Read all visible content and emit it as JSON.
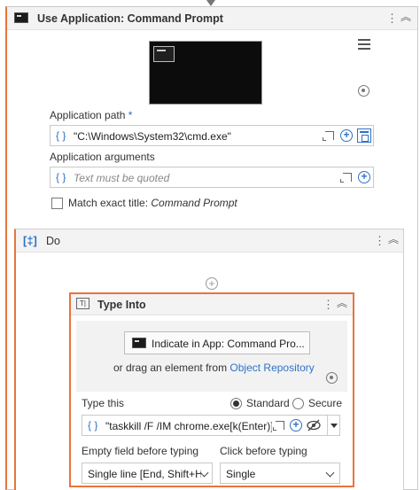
{
  "activity": {
    "title": "Use Application: Command Prompt",
    "application_path_label": "Application path",
    "required_mark": "*",
    "application_path_value": "\"C:\\Windows\\System32\\cmd.exe\"",
    "application_arguments_label": "Application arguments",
    "application_arguments_placeholder": "Text must be quoted",
    "match_exact_title_prefix": "Match exact title:",
    "match_exact_title_value": "Command Prompt",
    "match_exact_title_checked": false
  },
  "do": {
    "title": "Do"
  },
  "type_into": {
    "title": "Type Into",
    "indicate_button_label": "Indicate in App: Command Pro...",
    "drag_prefix": "or drag an element from",
    "object_repository_link": "Object Repository",
    "type_this_label": "Type this",
    "mode_standard": "Standard",
    "mode_secure": "Secure",
    "mode_selected": "Standard",
    "type_this_value": "\"taskkill /F /IM chrome.exe[k(Enter)]",
    "empty_field_label": "Empty field before typing",
    "empty_field_value": "Single line [End, Shift+H",
    "click_before_label": "Click before typing",
    "click_before_value": "Single"
  },
  "icons": {
    "brace": "{ }",
    "more": "⋮",
    "collapse": "︽",
    "plus": "+",
    "seq": "[‡]"
  },
  "colors": {
    "accent_orange": "#e8743b",
    "link_blue": "#2f72c8"
  }
}
